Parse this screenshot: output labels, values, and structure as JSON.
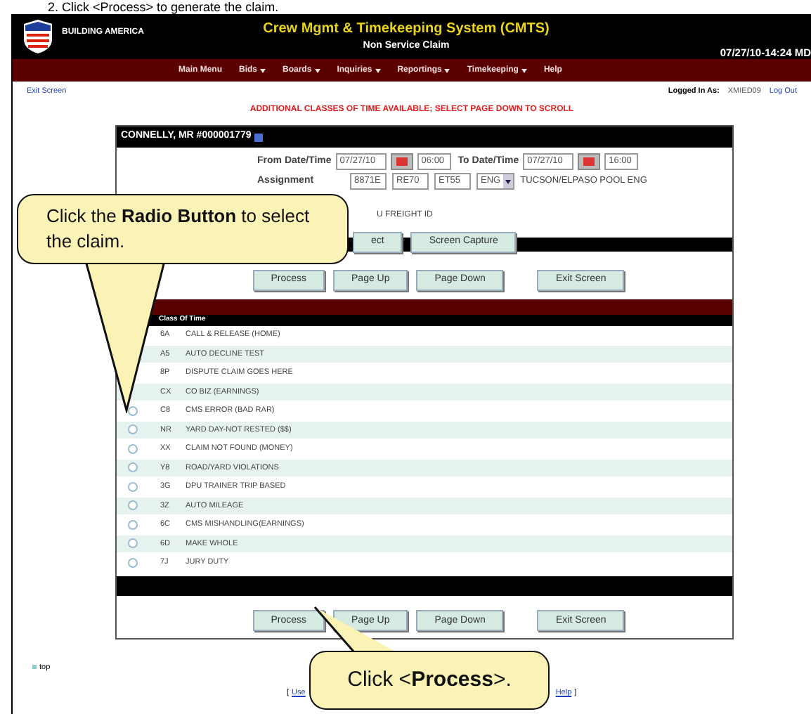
{
  "instruction": "2.  Click <Process> to generate the claim.",
  "header": {
    "brand": "BUILDING AMERICA",
    "title": "Crew Mgmt & Timekeeping System (CMTS)",
    "subtitle": "Non Service Claim",
    "datetime": "07/27/10-14:24 MD"
  },
  "menu": [
    {
      "label": "Main Menu",
      "dropdown": false
    },
    {
      "label": "Bids",
      "dropdown": true
    },
    {
      "label": "Boards",
      "dropdown": true
    },
    {
      "label": "Inquiries",
      "dropdown": true
    },
    {
      "label": "Reportings",
      "dropdown": true
    },
    {
      "label": "Timekeeping",
      "dropdown": true
    },
    {
      "label": "Help",
      "dropdown": false
    }
  ],
  "exit_link": "Exit Screen",
  "logged_in_label": "Logged In As:",
  "user": "XMIED09",
  "logout": "Log Out",
  "notice": "ADDITIONAL CLASSES OF TIME AVAILABLE; SELECT PAGE DOWN TO SCROLL",
  "employee": "CONNELLY, MR #000001779",
  "form": {
    "from_label": "From Date/Time",
    "from_date": "07/27/10",
    "from_time": "06:00",
    "to_label": "To Date/Time",
    "to_date": "07/27/10",
    "to_time": "16:00",
    "assignment_label": "Assignment",
    "assignment_fields": [
      "8871E",
      "RE70",
      "ET55"
    ],
    "craft": "ENG",
    "assignment_desc": "TUCSON/ELPASO POOL ENG",
    "freight_fragment": "U FREIGHT ID",
    "select_fragment": "ect",
    "capture": "Screen Capture"
  },
  "buttons_top": [
    "Process",
    "Page Up",
    "Page Down",
    "Exit Screen"
  ],
  "table": {
    "column": "Class Of Time",
    "rows": [
      {
        "code": "6A",
        "label": "CALL & RELEASE (HOME)"
      },
      {
        "code": "A5",
        "label": "AUTO DECLINE TEST"
      },
      {
        "code": "8P",
        "label": "DISPUTE CLAIM GOES HERE"
      },
      {
        "code": "CX",
        "label": "CO BIZ (EARNINGS)"
      },
      {
        "code": "C8",
        "label": "CMS ERROR (BAD RAR)",
        "selected": false
      },
      {
        "code": "NR",
        "label": "YARD DAY-NOT RESTED ($$)",
        "selected": false
      },
      {
        "code": "XX",
        "label": "CLAIM NOT FOUND (MONEY)",
        "selected": false
      },
      {
        "code": "Y8",
        "label": "ROAD/YARD VIOLATIONS",
        "selected": false
      },
      {
        "code": "3G",
        "label": "DPU TRAINER TRIP BASED",
        "selected": false
      },
      {
        "code": "3Z",
        "label": "AUTO MILEAGE",
        "selected": false
      },
      {
        "code": "6C",
        "label": "CMS MISHANDLING(EARNINGS)",
        "selected": false
      },
      {
        "code": "6D",
        "label": "MAKE WHOLE",
        "selected": false
      },
      {
        "code": "7J",
        "label": "JURY DUTY",
        "selected": false
      }
    ]
  },
  "buttons_bottom": [
    "Process",
    "Page Up",
    "Page Down",
    "Exit Screen"
  ],
  "top_link": "top",
  "footer": {
    "open": "[",
    "left": "Use",
    "right": "Help",
    "close": "]"
  },
  "callouts": [
    {
      "text": "Click the **Radio Button** to select the claim."
    },
    {
      "text": "Click <**Process**>."
    }
  ]
}
